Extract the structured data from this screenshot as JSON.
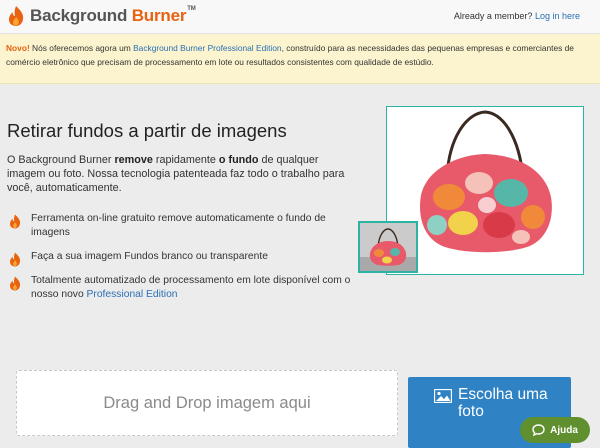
{
  "header": {
    "logo_text_primary": "Background",
    "logo_text_accent": "Burner",
    "logo_tm": "TM",
    "member_prompt": "Already a member?",
    "login_label": "Log in here"
  },
  "notice": {
    "novo": "Novo!",
    "text_before": " Nós oferecemos agora um ",
    "link_label": "Background Burner Professional Edition",
    "text_after": ", construído para as necessidades das pequenas empresas e comerciantes de comércio eletrônico que precisam de processamento em lote ou resultados consistentes com qualidade de estúdio."
  },
  "main": {
    "headline": "Retirar fundos a partir de imagens",
    "intro_1": "O Background Burner ",
    "intro_bold_1": "remove",
    "intro_2": " rapidamente ",
    "intro_bold_2": "o fundo",
    "intro_3": " de qualquer imagem ou foto. Nossa tecnologia patenteada faz todo o trabalho para você, automaticamente.",
    "bullets": [
      {
        "text": "Ferramenta on-line gratuito remove automaticamente o fundo de imagens"
      },
      {
        "text": "Faça a sua imagem Fundos branco ou transparente"
      },
      {
        "text": "Totalmente automatizado de processamento em lote disponível com o nosso novo ",
        "link": "Professional Edition"
      }
    ]
  },
  "upload": {
    "dropzone_label": "Drag and Drop imagem aqui",
    "choose_label": "Escolha uma foto",
    "choose_icon": "image-icon"
  },
  "help": {
    "label": "Ajuda",
    "icon": "chat-bubble-icon"
  },
  "colors": {
    "brand_orange": "#e8620f",
    "link_blue": "#2b6fb3",
    "button_blue": "#2f82c4",
    "teal_border": "#2bb3a3",
    "help_green": "#5f8f2f",
    "notice_bg": "#fcf4cf"
  }
}
